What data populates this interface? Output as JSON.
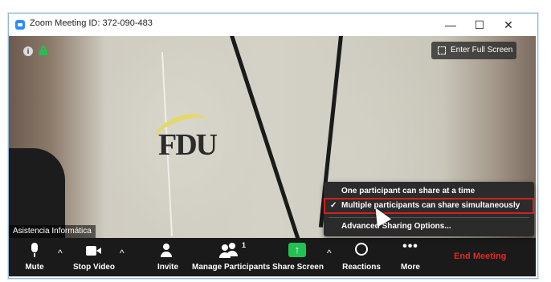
{
  "window": {
    "title": "Zoom Meeting ID: 372-090-483",
    "minimize_glyph": "—",
    "maximize_glyph": "☐",
    "close_glyph": "✕"
  },
  "video": {
    "fullscreen_label": "Enter Full Screen",
    "participant_name": "Asistencia Informática",
    "logo_text": "FDU",
    "info_glyph": "i"
  },
  "toolbar": {
    "mute_label": "Mute",
    "stop_video_label": "Stop Video",
    "invite_label": "Invite",
    "manage_participants_label": "Manage Participants",
    "participant_count": "1",
    "share_screen_label": "Share Screen",
    "reactions_label": "Reactions",
    "more_label": "More",
    "more_glyph": "•••",
    "end_meeting_label": "End Meeting",
    "caret_glyph": "^"
  },
  "share_menu": {
    "options": [
      {
        "label": "One participant can share at a time",
        "checked": false
      },
      {
        "label": "Multiple participants can share simultaneously",
        "checked": true
      }
    ],
    "advanced_label": "Advanced Sharing Options...",
    "check_glyph": "✓"
  },
  "colors": {
    "accent_blue": "#2d8cff",
    "share_green": "#23c152",
    "end_red": "#e02828",
    "toolbar_bg": "#1a1a1a",
    "highlight_red": "#d42020"
  },
  "icons": [
    "app-icon",
    "info-icon",
    "lock-icon",
    "fullscreen-icon",
    "mic-icon",
    "camera-icon",
    "invite-icon",
    "participants-icon",
    "share-screen-icon",
    "reactions-icon",
    "more-icon",
    "cursor-icon"
  ]
}
